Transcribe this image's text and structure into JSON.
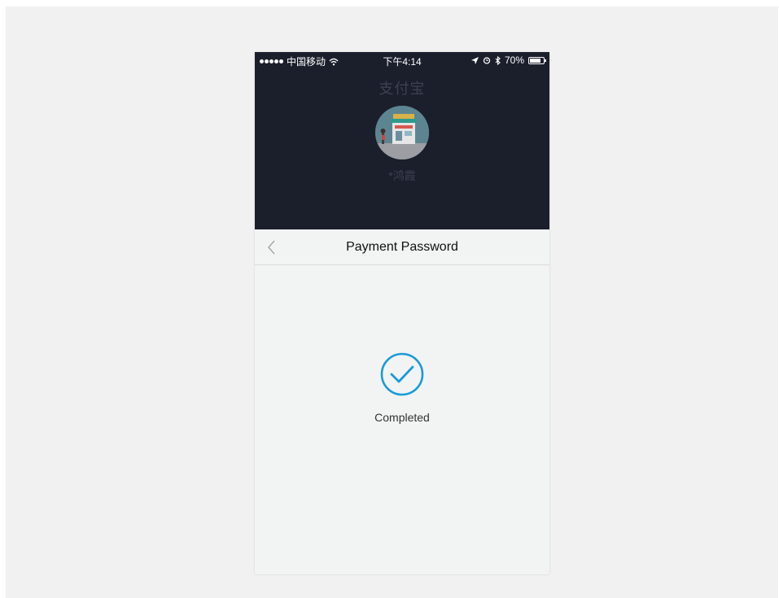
{
  "status_bar": {
    "carrier": "中国移动",
    "time": "下午4:14",
    "battery": "70%"
  },
  "merchant": {
    "title": "支付宝",
    "name": "*鸿霞"
  },
  "nav": {
    "title": "Payment Password"
  },
  "result": {
    "status": "Completed"
  },
  "colors": {
    "accent": "#1a9bd7",
    "header_bg": "#1b1f2c",
    "page_bg": "#f2f3f3"
  }
}
